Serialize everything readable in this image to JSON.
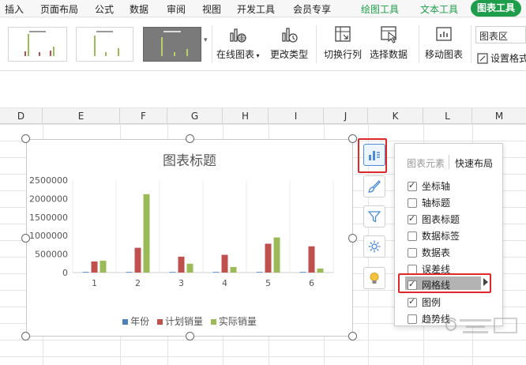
{
  "menu": {
    "items": [
      "插入",
      "页面布局",
      "公式",
      "数据",
      "审阅",
      "视图",
      "开发工具",
      "会员专享"
    ],
    "green_items": [
      "绘图工具",
      "文本工具"
    ],
    "active_pill": "图表工具"
  },
  "ribbon": {
    "online_chart": "在线图表",
    "change_type": "更改类型",
    "switch_row_col": "切换行列",
    "select_data": "选择数据",
    "move_chart": "移动图表",
    "chart_area": "图表区",
    "set_format": "设置格式"
  },
  "columns": [
    "D",
    "E",
    "F",
    "G",
    "H",
    "I",
    "J",
    "K",
    "L",
    "M"
  ],
  "chart": {
    "title": "图表标题",
    "legend": [
      "年份",
      "计划销量",
      "实际销量"
    ]
  },
  "chart_data": {
    "type": "bar",
    "title": "图表标题",
    "categories": [
      "1",
      "2",
      "3",
      "4",
      "5",
      "6"
    ],
    "series": [
      {
        "name": "年份",
        "values": [
          2015,
          2016,
          2017,
          2018,
          2019,
          2020
        ]
      },
      {
        "name": "计划销量",
        "values": [
          300000,
          670000,
          430000,
          480000,
          780000,
          710000
        ]
      },
      {
        "name": "实际销量",
        "values": [
          320000,
          2120000,
          240000,
          150000,
          950000,
          110000
        ]
      }
    ],
    "y_ticks": [
      "0",
      "500000",
      "1000000",
      "1500000",
      "2000000",
      "2500000"
    ],
    "ylim": [
      0,
      2500000
    ],
    "grid": true,
    "legend_position": "bottom",
    "colors": [
      "#4f81bd",
      "#c0504d",
      "#9bbb59"
    ]
  },
  "panel": {
    "tab_elements": "图表元素",
    "tab_layout": "快速布局",
    "options": [
      {
        "label": "坐标轴",
        "checked": true
      },
      {
        "label": "轴标题",
        "checked": false
      },
      {
        "label": "图表标题",
        "checked": true
      },
      {
        "label": "数据标签",
        "checked": false
      },
      {
        "label": "数据表",
        "checked": false
      },
      {
        "label": "误差线",
        "checked": false
      },
      {
        "label": "网格线",
        "checked": true
      },
      {
        "label": "图例",
        "checked": true
      },
      {
        "label": "趋势线",
        "checked": false
      }
    ]
  },
  "watermark": "经验"
}
